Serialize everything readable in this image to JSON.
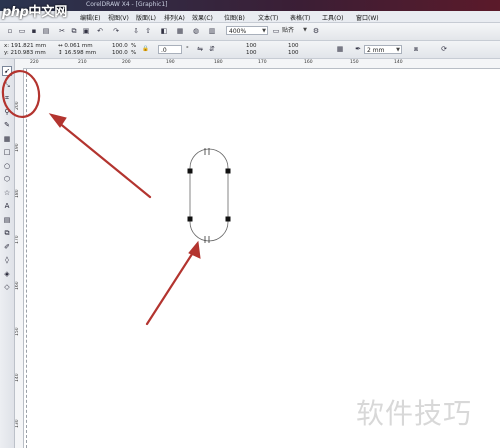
{
  "logo": {
    "brand": "php",
    "site": "中文网"
  },
  "window_title": "CorelDRAW X4 - [Graphic1]",
  "menu": [
    "编辑(E)",
    "视图(V)",
    "版面(L)",
    "排列(A)",
    "效果(C)",
    "位图(B)",
    "文本(T)",
    "表格(T)",
    "工具(O)",
    "窗口(W)"
  ],
  "toolbar": {
    "zoom_level": "400%",
    "snap_label": "贴齐",
    "outline_width": ".2 mm",
    "rotation": ".0"
  },
  "properties": {
    "x": "191.821 mm",
    "y": "210.983 mm",
    "width": "0.061 mm",
    "height": "16.598 mm",
    "scale_w": "100.0",
    "scale_h": "100.0",
    "corner_1": "100",
    "corner_2": "100",
    "corner_3": "100",
    "corner_4": "100",
    "outline": "2 mm"
  },
  "ruler_h_ticks": [
    "220",
    "210",
    "200",
    "190",
    "180",
    "170",
    "160",
    "150",
    "140"
  ],
  "ruler_v_ticks": [
    "200",
    "190",
    "180",
    "170",
    "160",
    "150",
    "140",
    "130"
  ],
  "tools": [
    "pick-tool-icon",
    "shape-tool-icon",
    "crop-tool-icon",
    "zoom-tool-icon",
    "freehand-tool-icon",
    "smart-fill-tool-icon",
    "rectangle-tool-icon",
    "ellipse-tool-icon",
    "polygon-tool-icon",
    "basic-shapes-tool-icon",
    "text-tool-icon",
    "table-tool-icon",
    "interactive-blend-tool-icon",
    "eyedropper-tool-icon",
    "outline-tool-icon",
    "fill-tool-icon",
    "interactive-fill-tool-icon"
  ],
  "tool_glyphs": [
    "➹",
    "⤡",
    "⌗",
    "⚲",
    "✎",
    "▦",
    "□",
    "○",
    "⬡",
    "☆",
    "A",
    "▤",
    "⧉",
    "✐",
    "◊",
    "◈",
    "◇"
  ],
  "watermark": "软件技巧",
  "colors": {
    "annotation_red": "#b3342f",
    "selection_handle": "#111111"
  }
}
